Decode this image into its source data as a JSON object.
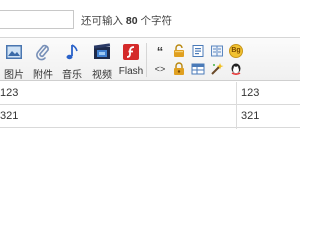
{
  "header": {
    "counter_prefix": "还可输入",
    "counter_value": "80",
    "counter_suffix": "个字符"
  },
  "toolbar": {
    "buttons": [
      {
        "label": "图片",
        "icon": "image-icon"
      },
      {
        "label": "附件",
        "icon": "paperclip-icon"
      },
      {
        "label": "音乐",
        "icon": "music-note-icon"
      },
      {
        "label": "视频",
        "icon": "film-icon"
      },
      {
        "label": "Flash",
        "icon": "flash-icon"
      }
    ],
    "small_tools": [
      {
        "icon": "quote-icon",
        "glyph": "“"
      },
      {
        "icon": "code-icon",
        "glyph": "<>"
      },
      {
        "icon": "free-content-icon"
      },
      {
        "icon": "hide-content-icon"
      },
      {
        "icon": "post-message-icon"
      },
      {
        "icon": "table-icon"
      },
      {
        "icon": "page-icon"
      },
      {
        "icon": "magic-wand-icon"
      },
      {
        "icon": "bg-icon",
        "glyph": "Bg"
      },
      {
        "icon": "qq-icon"
      }
    ]
  },
  "table": {
    "rows": [
      [
        "123",
        "123"
      ],
      [
        "321",
        "321"
      ]
    ]
  },
  "colors": {
    "toolbar_bg": "#f3f3f3",
    "border": "#d6d6d6",
    "flash_red": "#d42a2a",
    "music_blue": "#2a62c9"
  }
}
